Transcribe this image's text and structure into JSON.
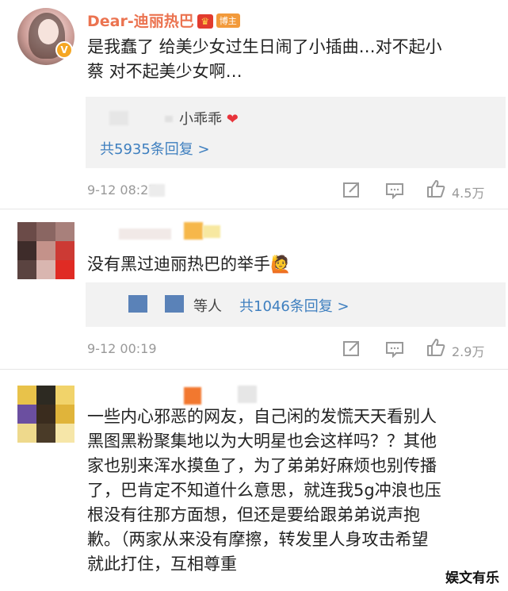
{
  "comments": [
    {
      "name": "Dear-迪丽热巴",
      "host_badge": "博主",
      "text_lines": [
        "是我蠢了 给美少女过生日闹了小插曲…对不起小",
        "蔡 对不起美少女啊…"
      ],
      "reply_preview": "小乖乖",
      "reply_total": "共5935条回复 >",
      "time": "9-12 08:27",
      "likes": "4.5万"
    },
    {
      "text": "没有黑过迪丽热巴的举手🙋",
      "reply_prefix": "等人",
      "reply_total": "共1046条回复 >",
      "time": "9-12 00:19",
      "likes": "2.9万"
    },
    {
      "text_lines": [
        "一些内心邪恶的网友，自己闲的发慌天天看别人",
        "黑图黑粉聚集地以为大明星也会这样吗？？其他",
        "家也别来浑水摸鱼了，为了弟弟好麻烦也别传播",
        "了，巴肯定不知道什么意思，就连我5g冲浪也压",
        "根没有往那方面想，但还是要给跟弟弟说声抱",
        "歉。（两家从来没有摩擦，转发里人身攻击希望",
        "就此打住，互相尊重"
      ]
    }
  ],
  "watermark": "娱文有乐",
  "colors": {
    "name": "#eb7350",
    "link": "#3e7fbf",
    "meta": "#999999",
    "reply_bg": "#f2f2f2"
  },
  "icons": [
    "share-icon",
    "comment-icon",
    "like-icon",
    "verified-badge-icon",
    "crown-icon",
    "heart-icon"
  ]
}
